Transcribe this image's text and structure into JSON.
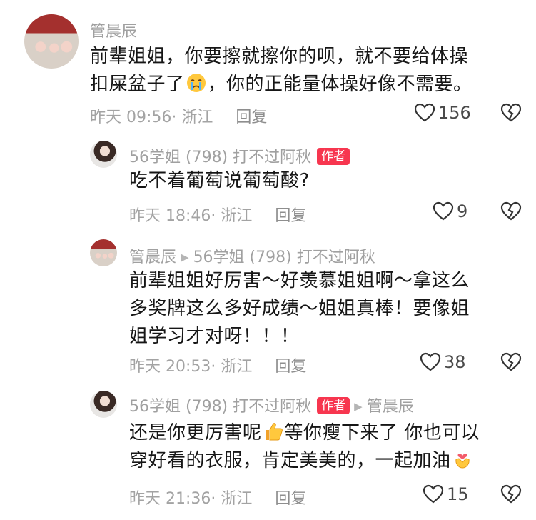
{
  "comments": [
    {
      "author": "管晨辰",
      "text_line1": "前辈姐姐，你要擦就擦你的呗，就不要给体操",
      "text_line2_a": "扣屎盆子了",
      "text_line2_b": "，你的正能量体操好像不需要。",
      "emoji": "crying-face",
      "time": "昨天 09:56",
      "location": "· 浙江",
      "reply_label": "回复",
      "likes": "156"
    },
    {
      "author": "56学姐 (798) 打不过阿秋",
      "badge": "作者",
      "text_line1": "吃不着葡萄说葡萄酸?",
      "time": "昨天 18:46",
      "location": "· 浙江",
      "reply_label": "回复",
      "likes": "9"
    },
    {
      "author": "管晨辰",
      "reply_to": "56学姐 (798) 打不过阿秋",
      "text_line1": "前辈姐姐好厉害～好羡慕姐姐啊～拿这么",
      "text_line2": "多奖牌这么多好成绩～姐姐真棒！要像姐",
      "text_line3": "姐学习才对呀！！！",
      "time": "昨天 20:53",
      "location": "· 浙江",
      "reply_label": "回复",
      "likes": "38"
    },
    {
      "author": "56学姐 (798) 打不过阿秋",
      "badge": "作者",
      "reply_to": "管晨辰",
      "text_line1_a": "还是你更厉害呢",
      "text_line1_b": "等你瘦下来了 你也可以",
      "text_line2_a": "穿好看的衣服，肯定美美的，一起加油",
      "emoji1": "thumbs-up",
      "emoji2": "fist-bump-heart",
      "time": "昨天 21:36",
      "location": "· 浙江",
      "reply_label": "回复",
      "likes": "15"
    }
  ],
  "colors": {
    "badge": "#f7364f",
    "meta": "#a3a3a3",
    "name": "#a0a0a0",
    "text": "#161616"
  }
}
